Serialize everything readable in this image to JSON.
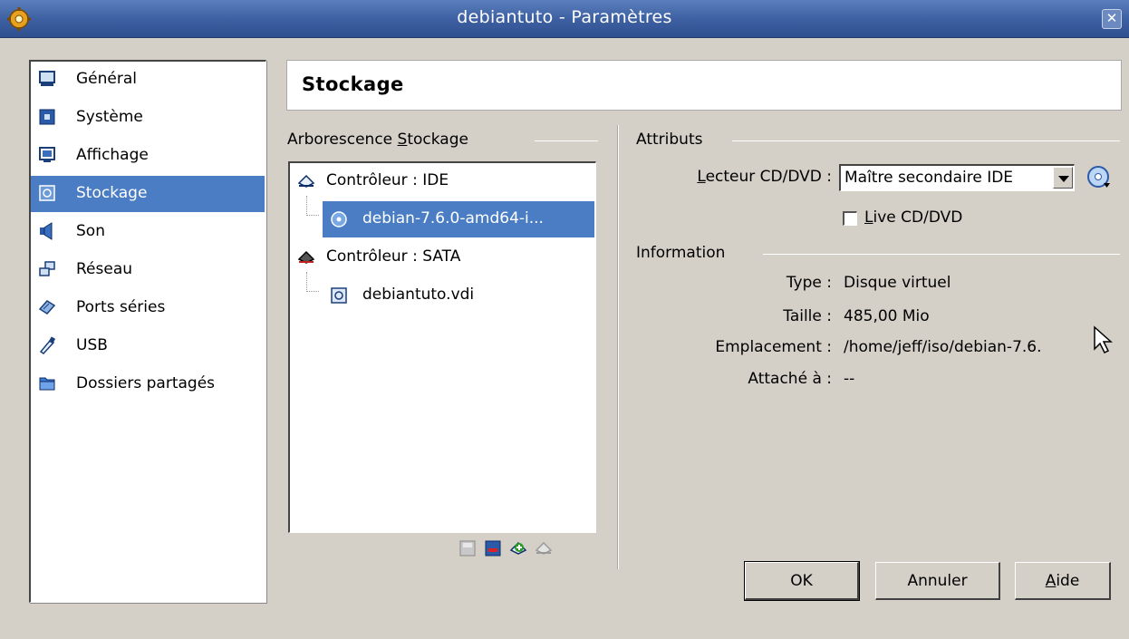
{
  "window": {
    "title": "debiantuto - Paramètres",
    "title_icon": "gear-icon",
    "close_icon": "close-icon",
    "close_glyph": "✕"
  },
  "sidebar": {
    "items": [
      {
        "label": "Général",
        "icon": "monitor-icon"
      },
      {
        "label": "Système",
        "icon": "chip-icon"
      },
      {
        "label": "Affichage",
        "icon": "display-icon"
      },
      {
        "label": "Stockage",
        "icon": "storage-icon",
        "selected": true
      },
      {
        "label": "Son",
        "icon": "speaker-icon"
      },
      {
        "label": "Réseau",
        "icon": "network-icon"
      },
      {
        "label": "Ports séries",
        "icon": "serial-port-icon"
      },
      {
        "label": "USB",
        "icon": "usb-icon"
      },
      {
        "label": "Dossiers partagés",
        "icon": "folder-icon"
      }
    ]
  },
  "header": {
    "title": "Stockage"
  },
  "tree_panel": {
    "title_pre": "Arborescence ",
    "title_ul": "S",
    "title_post": "tockage",
    "rows": [
      {
        "label": "Contrôleur : IDE",
        "icon": "ide-controller-icon"
      },
      {
        "label": "debian-7.6.0-amd64-i...",
        "icon": "cd-disc-icon",
        "selected": true
      },
      {
        "label": "Contrôleur : SATA",
        "icon": "sata-controller-icon"
      },
      {
        "label": "debiantuto.vdi",
        "icon": "hard-disk-icon"
      }
    ],
    "toolbar": [
      "add-attachment-icon",
      "remove-attachment-icon",
      "add-controller-icon",
      "remove-controller-icon"
    ]
  },
  "attributes": {
    "title": "Attributs",
    "cd_label_ul": "L",
    "cd_label_rest": "ecteur CD/DVD :",
    "cd_value": "Maître secondaire IDE",
    "live_ul": "L",
    "live_rest": "ive CD/DVD",
    "live_checked": false
  },
  "information": {
    "title": "Information",
    "rows": [
      {
        "label": "Type :",
        "value": "Disque virtuel"
      },
      {
        "label": "Taille :",
        "value": "485,00 Mio"
      },
      {
        "label": "Emplacement :",
        "value": "/home/jeff/iso/debian-7.6."
      },
      {
        "label": "Attaché à :",
        "value": "--"
      }
    ]
  },
  "buttons": {
    "ok": "OK",
    "cancel": "Annuler",
    "help_ul": "A",
    "help_rest": "ide"
  },
  "colors": {
    "selection": "#4a7dc4",
    "titlebar": "#3f62a4",
    "dialog_bg": "#d4d0c8"
  }
}
